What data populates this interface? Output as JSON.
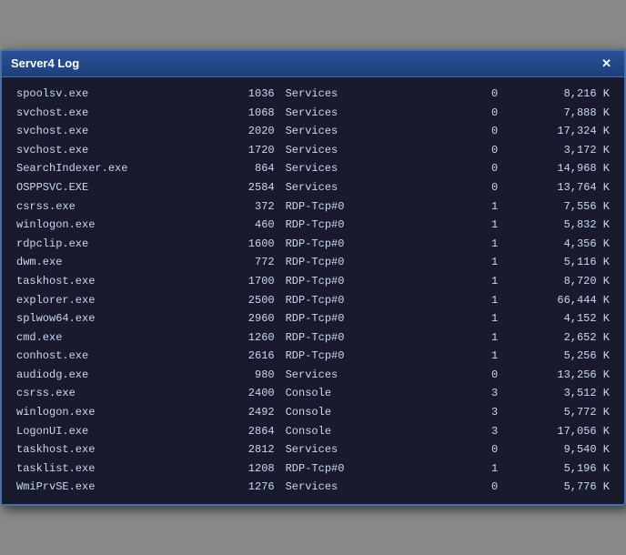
{
  "window": {
    "title": "Server4 Log",
    "close_label": "✕"
  },
  "rows": [
    {
      "name": "spoolsv.exe",
      "pid": "1036",
      "session": "Services",
      "num": "0",
      "mem": "8,216 K"
    },
    {
      "name": "svchost.exe",
      "pid": "1068",
      "session": "Services",
      "num": "0",
      "mem": "7,888 K"
    },
    {
      "name": "svchost.exe",
      "pid": "2020",
      "session": "Services",
      "num": "0",
      "mem": "17,324 K"
    },
    {
      "name": "svchost.exe",
      "pid": "1720",
      "session": "Services",
      "num": "0",
      "mem": "3,172 K"
    },
    {
      "name": "SearchIndexer.exe",
      "pid": "864",
      "session": "Services",
      "num": "0",
      "mem": "14,968 K"
    },
    {
      "name": "OSPPSVC.EXE",
      "pid": "2584",
      "session": "Services",
      "num": "0",
      "mem": "13,764 K"
    },
    {
      "name": "csrss.exe",
      "pid": "372",
      "session": "RDP-Tcp#0",
      "num": "1",
      "mem": "7,556 K"
    },
    {
      "name": "winlogon.exe",
      "pid": "460",
      "session": "RDP-Tcp#0",
      "num": "1",
      "mem": "5,832 K"
    },
    {
      "name": "rdpclip.exe",
      "pid": "1600",
      "session": "RDP-Tcp#0",
      "num": "1",
      "mem": "4,356 K"
    },
    {
      "name": "dwm.exe",
      "pid": "772",
      "session": "RDP-Tcp#0",
      "num": "1",
      "mem": "5,116 K"
    },
    {
      "name": "taskhost.exe",
      "pid": "1700",
      "session": "RDP-Tcp#0",
      "num": "1",
      "mem": "8,720 K"
    },
    {
      "name": "explorer.exe",
      "pid": "2500",
      "session": "RDP-Tcp#0",
      "num": "1",
      "mem": "66,444 K"
    },
    {
      "name": "splwow64.exe",
      "pid": "2960",
      "session": "RDP-Tcp#0",
      "num": "1",
      "mem": "4,152 K"
    },
    {
      "name": "cmd.exe",
      "pid": "1260",
      "session": "RDP-Tcp#0",
      "num": "1",
      "mem": "2,652 K"
    },
    {
      "name": "conhost.exe",
      "pid": "2616",
      "session": "RDP-Tcp#0",
      "num": "1",
      "mem": "5,256 K"
    },
    {
      "name": "audiodg.exe",
      "pid": "980",
      "session": "Services",
      "num": "0",
      "mem": "13,256 K"
    },
    {
      "name": "csrss.exe",
      "pid": "2400",
      "session": "Console",
      "num": "3",
      "mem": "3,512 K"
    },
    {
      "name": "winlogon.exe",
      "pid": "2492",
      "session": "Console",
      "num": "3",
      "mem": "5,772 K"
    },
    {
      "name": "LogonUI.exe",
      "pid": "2864",
      "session": "Console",
      "num": "3",
      "mem": "17,056 K"
    },
    {
      "name": "taskhost.exe",
      "pid": "2812",
      "session": "Services",
      "num": "0",
      "mem": "9,540 K"
    },
    {
      "name": "tasklist.exe",
      "pid": "1208",
      "session": "RDP-Tcp#0",
      "num": "1",
      "mem": "5,196 K"
    },
    {
      "name": "WmiPrvSE.exe",
      "pid": "1276",
      "session": "Services",
      "num": "0",
      "mem": "5,776 K"
    }
  ]
}
